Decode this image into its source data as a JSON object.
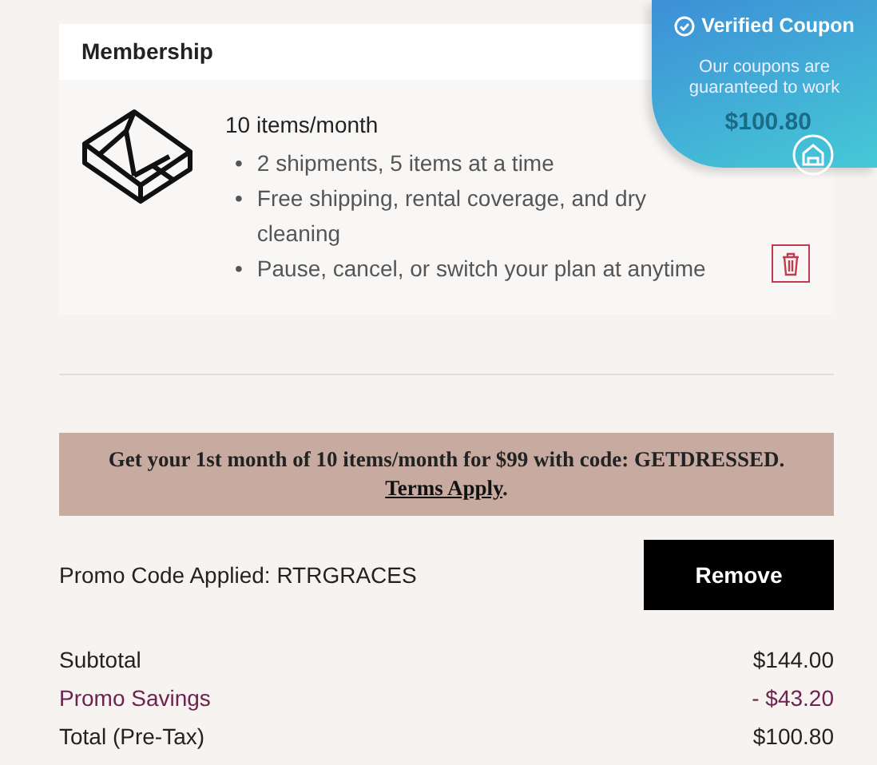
{
  "membership": {
    "title": "Membership",
    "plan": "10 items/month",
    "bullet": "•",
    "features": [
      "2 shipments, 5 items at a time",
      "Free shipping, rental coverage, and dry cleaning",
      "Pause, cancel, or switch your plan at anytime"
    ],
    "price": "$100.80"
  },
  "coupon_badge": {
    "title": "Verified Coupon",
    "text": "Our coupons are guaranteed to work"
  },
  "promo_banner": {
    "text": "Get your 1st month of 10 items/month for $99 with code: GETDRESSED.",
    "link": "Terms Apply",
    "after": "."
  },
  "promo_code": {
    "label": "Promo Code Applied: RTRGRACES",
    "button": "Remove"
  },
  "totals": [
    {
      "label": "Subtotal",
      "value": "$144.00",
      "kind": "plain"
    },
    {
      "label": "Promo Savings",
      "value": "- $43.20",
      "kind": "savings"
    },
    {
      "label": "Total (Pre-Tax)",
      "value": "$100.80",
      "kind": "plain"
    }
  ]
}
